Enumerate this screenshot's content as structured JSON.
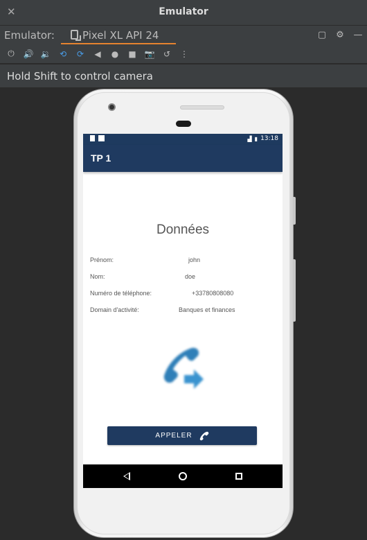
{
  "window": {
    "title": "Emulator",
    "close_glyph": "✕"
  },
  "tabbar": {
    "label": "Emulator:",
    "device_tab": "Pixel XL API 24",
    "accent_color": "#e6832f",
    "actions": [
      "restore-icon",
      "gear-icon",
      "minimize-icon"
    ]
  },
  "toolbar": {
    "buttons": [
      "power-icon",
      "volume-up-icon",
      "volume-down-icon",
      "rotate-left-icon",
      "rotate-right-icon",
      "back-icon",
      "home-icon",
      "overview-icon",
      "camera-icon",
      "replay-icon",
      "more-icon"
    ]
  },
  "hint": "Hold Shift to control camera",
  "device": {
    "status_time": "13:18",
    "app_title": "TP 1",
    "app_bar_color": "#1f3a60",
    "heading": "Données",
    "fields": [
      {
        "key": "Prénom:",
        "value": "john"
      },
      {
        "key": "Nom:",
        "value": "doe"
      },
      {
        "key": "Numéro de téléphone:",
        "value": "+33780808080"
      },
      {
        "key": "Domain d'activité:",
        "value": "Banques et finances"
      }
    ],
    "call_button": "APPELER"
  }
}
